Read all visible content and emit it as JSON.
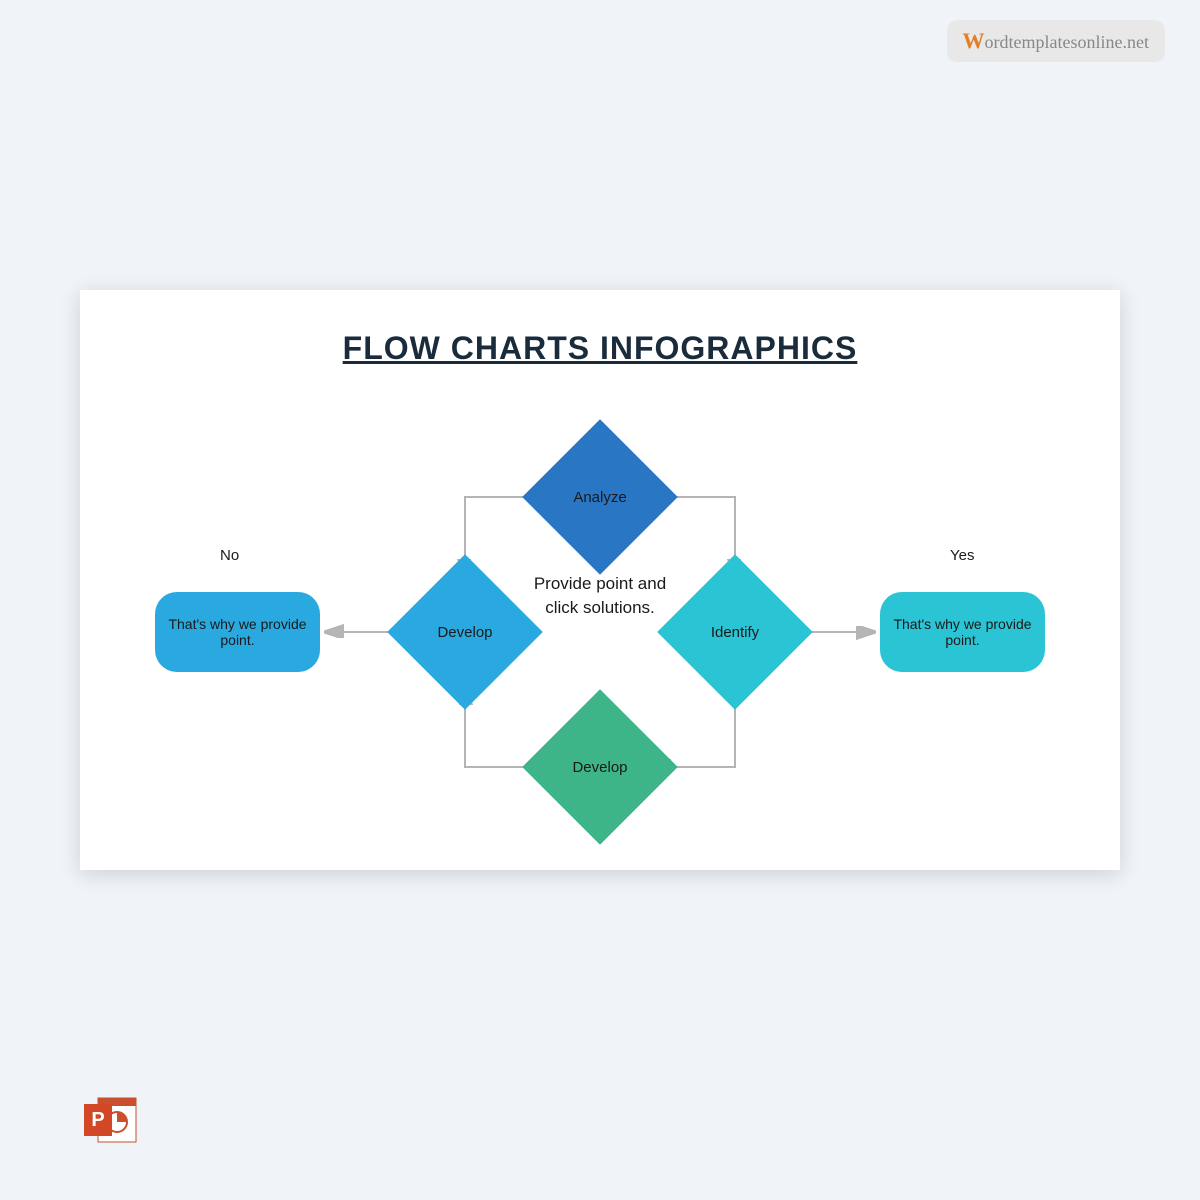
{
  "watermark": {
    "letter": "W",
    "text": "ordtemplatesonline.net"
  },
  "slide": {
    "title": "FLOW CHARTS INFOGRAPHICS"
  },
  "diagram": {
    "nodes": {
      "analyze": "Analyze",
      "develop_left": "Develop",
      "identify": "Identify",
      "develop_bottom": "Develop"
    },
    "center_text": "Provide point and click solutions.",
    "branches": {
      "no": {
        "label": "No",
        "text": "That's why we provide point."
      },
      "yes": {
        "label": "Yes",
        "text": "That's why we provide point."
      }
    }
  },
  "colors": {
    "analyze": "#2976c4",
    "develop_left": "#29a9e0",
    "identify": "#2bc4d4",
    "develop_bottom": "#3eb489",
    "box_no": "#29a9e0",
    "box_yes": "#2bc4d4"
  }
}
